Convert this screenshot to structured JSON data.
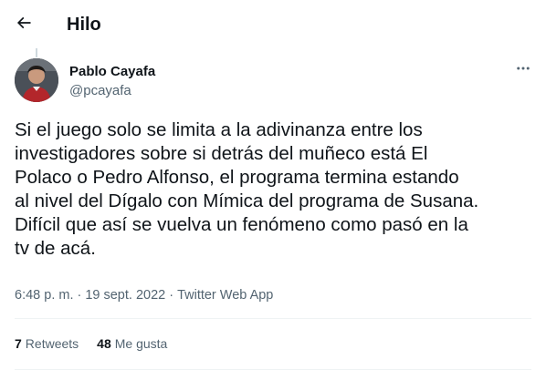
{
  "header": {
    "back_icon": "arrow-left-icon",
    "title": "Hilo"
  },
  "tweet": {
    "author": {
      "name": "Pablo Cayafa",
      "handle": "@pcayafa"
    },
    "more_icon": "more-horizontal-icon",
    "text": "Si el juego solo se limita a la adivinanza entre los\ninvestigadores sobre si detrás del muñeco está El\nPolaco o Pedro Alfonso, el programa termina estando\nal nivel del Dígalo con Mímica del programa de Susana.\nDifícil que así se vuelva un fenómeno como pasó en la\ntv de acá.",
    "time": "6:48 p. m.",
    "separator": "·",
    "date": "19 sept. 2022",
    "source": "Twitter Web App"
  },
  "stats": {
    "retweets_count": "7",
    "retweets_label": "Retweets",
    "likes_count": "48",
    "likes_label": "Me gusta"
  },
  "colors": {
    "text_primary": "#0f1419",
    "text_secondary": "#536471",
    "divider": "#eff3f4"
  }
}
